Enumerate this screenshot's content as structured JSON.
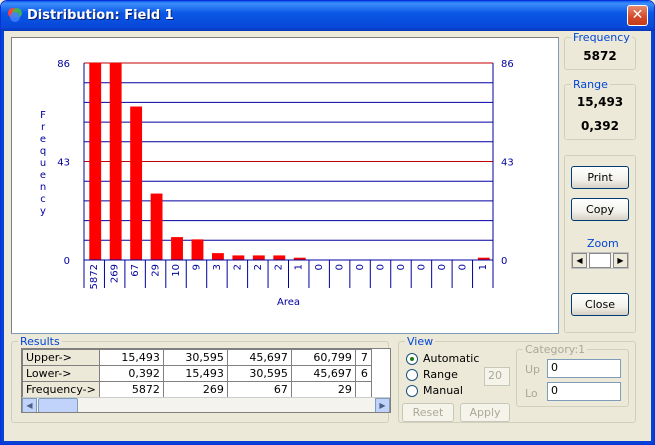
{
  "window": {
    "title": "Distribution: Field 1",
    "close_glyph": "✕"
  },
  "frequency": {
    "label": "Frequency",
    "value": "5872"
  },
  "range": {
    "label": "Range",
    "upper": "15,493",
    "lower": "0,392"
  },
  "buttons": {
    "print": "Print",
    "copy": "Copy",
    "close": "Close",
    "reset": "Reset",
    "apply": "Apply"
  },
  "zoom": {
    "label": "Zoom"
  },
  "results": {
    "label": "Results",
    "rows": [
      {
        "header": "Upper->",
        "cells": [
          "15,493",
          "30,595",
          "45,697",
          "60,799",
          "7"
        ]
      },
      {
        "header": "Lower->",
        "cells": [
          "0,392",
          "15,493",
          "30,595",
          "45,697",
          "6"
        ]
      },
      {
        "header": "Frequency->",
        "cells": [
          "5872",
          "269",
          "67",
          "29",
          ""
        ]
      }
    ]
  },
  "view": {
    "label": "View",
    "options": [
      "Automatic",
      "Range",
      "Manual"
    ],
    "selected": "Automatic",
    "range_count": "20"
  },
  "category": {
    "label": "Category:1",
    "up_label": "Up",
    "up_value": "0",
    "lo_label": "Lo",
    "lo_value": "0"
  },
  "colors": {
    "bar": "#ff0000",
    "gridline_major": "#c00000",
    "gridline_minor": "#0000a0",
    "axis_text": "#0000a0"
  },
  "chart_data": {
    "type": "bar",
    "ylabel": "Frequency",
    "xlabel": "Area",
    "y_ticks": [
      0,
      43,
      86
    ],
    "ylim": [
      0,
      86
    ],
    "categories": [
      "5872",
      "269",
      "67",
      "29",
      "10",
      "9",
      "3",
      "2",
      "2",
      "2",
      "1",
      "0",
      "0",
      "0",
      "0",
      "0",
      "0",
      "0",
      "0",
      "1"
    ],
    "values": [
      86,
      86,
      67,
      29,
      10,
      9,
      3,
      2,
      2,
      2,
      1,
      0,
      0,
      0,
      0,
      0,
      0,
      0,
      0,
      1
    ],
    "grid": true,
    "secondary_y_axis": true
  }
}
